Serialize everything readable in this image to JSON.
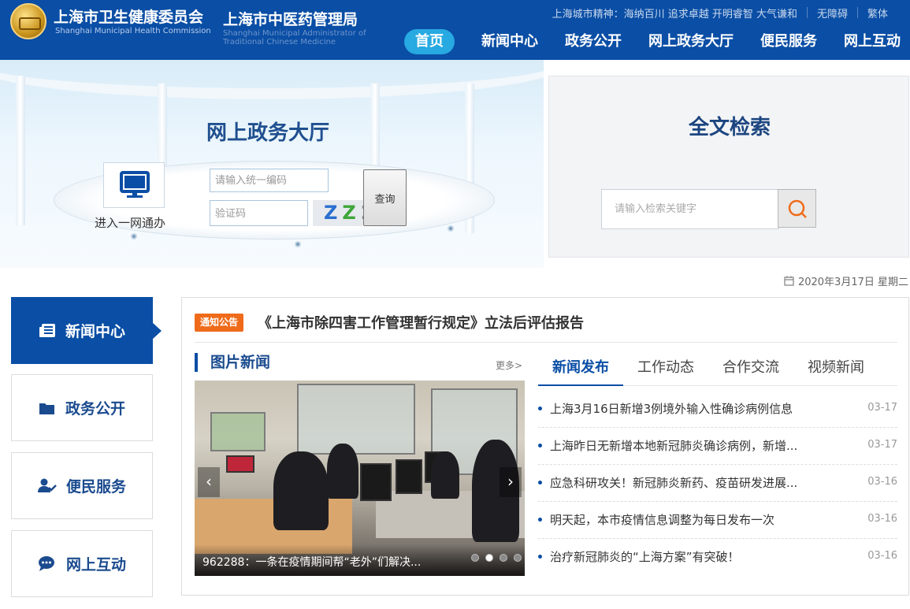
{
  "header": {
    "org1_cn": "上海市卫生健康委员会",
    "org1_en": "Shanghai Municipal Health Commission",
    "org2_cn": "上海市中医药管理局",
    "org2_en": "Shanghai Municipal Administrator of Traditional Chinese Medicine",
    "city_spirit": "上海城市精神：海纳百川 追求卓越 开明睿智 大气谦和",
    "accessibility": "无障碍",
    "traditional": "繁体",
    "nav": [
      "首页",
      "新闻中心",
      "政务公开",
      "网上政务大厅",
      "便民服务",
      "网上互动"
    ],
    "brand_color": "#0a4ea5",
    "active_nav_color": "#27a9e1"
  },
  "hall": {
    "title": "网上政务大厅",
    "one_net_label": "进入一网通办",
    "code_placeholder": "请输入统一编码",
    "captcha_placeholder": "验证码",
    "captcha_text": [
      "Z",
      "Z",
      "2"
    ],
    "query_button": "查询"
  },
  "search": {
    "title": "全文检索",
    "placeholder": "请输入检索关键字"
  },
  "date": "2020年3月17日 星期二",
  "side_menu": [
    {
      "label": "新闻中心",
      "icon": "news-icon"
    },
    {
      "label": "政务公开",
      "icon": "folder-icon"
    },
    {
      "label": "便民服务",
      "icon": "user-check-icon"
    },
    {
      "label": "网上互动",
      "icon": "chat-icon"
    }
  ],
  "notice": {
    "badge": "通知公告",
    "title": "《上海市除四害工作管理暂行规定》立法后评估报告"
  },
  "photo_news": {
    "heading": "图片新闻",
    "more": "更多>",
    "caption": "962288：一条在疫情期间帮“老外”们解决...",
    "slide_count": 4,
    "active_slide": 2
  },
  "news": {
    "tabs": [
      "新闻发布",
      "工作动态",
      "合作交流",
      "视频新闻"
    ],
    "items": [
      {
        "title": "上海3月16日新增3例境外输入性确诊病例信息",
        "date": "03-17"
      },
      {
        "title": "上海昨日无新增本地新冠肺炎确诊病例，新增...",
        "date": "03-17"
      },
      {
        "title": "应急科研攻关！新冠肺炎新药、疫苗研发进展...",
        "date": "03-16"
      },
      {
        "title": "明天起，本市疫情信息调整为每日发布一次",
        "date": "03-16"
      },
      {
        "title": "治疗新冠肺炎的“上海方案”有突破！",
        "date": "03-16"
      }
    ]
  }
}
